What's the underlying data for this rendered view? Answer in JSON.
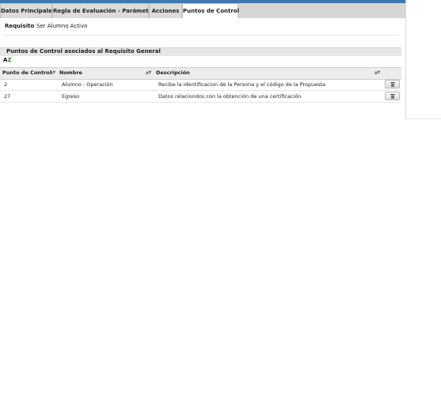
{
  "tabs": [
    {
      "label": "Datos Principales",
      "active": false
    },
    {
      "label": "Regla de Evaluación - Parámetros",
      "active": false
    },
    {
      "label": "Acciones",
      "active": false
    },
    {
      "label": "Puntos de Control",
      "active": true
    }
  ],
  "requisito": {
    "label": "Requisito",
    "value": "Ser Alumno Activo"
  },
  "section": {
    "title": "Puntos de Control asociados al Requisito General"
  },
  "sort_icon": {
    "label": "AZ",
    "icon": "az-sort-icon"
  },
  "table": {
    "columns": [
      {
        "label": "Punto de Control"
      },
      {
        "label": "Nombre"
      },
      {
        "label": "Descripción"
      }
    ],
    "sort_glyph": "▲▼",
    "rows": [
      {
        "punto": "2",
        "nombre": "Alumno - Operación",
        "descripcion": "Recibe la identificacion de la Persona y el código de la Propuesta"
      },
      {
        "punto": "27",
        "nombre": "Egreso",
        "descripcion": "Datos relaciondos con la obtención de una certificación"
      }
    ]
  },
  "colors": {
    "topbar": "#3f78ad",
    "tabbar": "#d6d6d6",
    "header": "#e6e6e6"
  }
}
